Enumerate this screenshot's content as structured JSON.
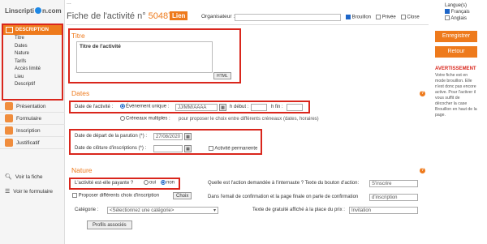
{
  "app": {
    "logo_left": "Linscripti",
    "logo_right": "n.com",
    "topline": "..."
  },
  "header": {
    "title_prefix": "Fiche de l'activité n°",
    "activity_number": "50487",
    "lien": "Lien",
    "organisateur_label": "Organisateur :",
    "organisateur_value": "",
    "brouillon": "Brouillon",
    "privee": "Privée",
    "close": "Close"
  },
  "langue": {
    "label": "Langue(s)",
    "fr": "Français",
    "en": "Anglais"
  },
  "sidebar": {
    "group_label": "DESCRIPTION",
    "items": [
      "Titre",
      "Dates",
      "Nature",
      "Tarifs",
      "Accès limité",
      "Lieu",
      "Descriptif"
    ],
    "nav": [
      "Présentation",
      "Formulaire",
      "Inscription",
      "Justificatif"
    ],
    "voir_fiche": "Voir la fiche",
    "voir_formulaire": "Voir le formulaire"
  },
  "titre": {
    "section": "Titre",
    "value": "Titre de l'activité",
    "html_btn": "HTML"
  },
  "dates": {
    "section": "Dates",
    "date_activite_label": "Date de l'activité :",
    "evenement_unique": "Événement unique :",
    "date_placeholder": "JJ/MM/AAAA",
    "h_debut": "h début :",
    "h_fin": "h fin :",
    "creneaux": "Créneaux multiples :",
    "creneaux_hint": "pour proposer le choix entre différents créneaux (dates, horaires)",
    "depart_label": "Date de départ de la parution (*) :",
    "depart_value": "27/08/2020",
    "cloture_label": "Date de clôture d'inscriptions (*) :",
    "cloture_value": "",
    "permanente": "Activité permanente"
  },
  "nature": {
    "section": "Nature",
    "payante_label": "L'activité est-elle payante ?",
    "oui": "oui",
    "non": "non",
    "proposer": "Proposer différents choix d'inscription",
    "choix_btn": "Choix",
    "categorie_label": "Catégorie :",
    "categorie_value": "<Sélectionnez une catégorie>",
    "profils_btn": "Profils associés",
    "action_label": "Quelle est l'action demandée à l'internaute ? Texte du bouton d'action:",
    "action_value": "S'inscrire",
    "email_label": "Dans l'email de confirmation et la page finale on parle de confirmation",
    "email_value": "d'inscription",
    "gratuite_label": "Texte de gratuité affiché à la place du prix :",
    "gratuite_value": "Invitation"
  },
  "actions": {
    "enregistrer": "Enregistrer",
    "retour": "Retour",
    "warn_title": "AVERTISSEMENT",
    "warn_text": "Votre fiche est en mode brouillon. Elle n'est donc pas encore active. Pour l'activer il vous suffit de décocher la case Brouillon en haut de la page."
  },
  "colors": {
    "accent": "#ee7a1c",
    "highlight": "#d9261c",
    "link": "#1e66c8"
  }
}
